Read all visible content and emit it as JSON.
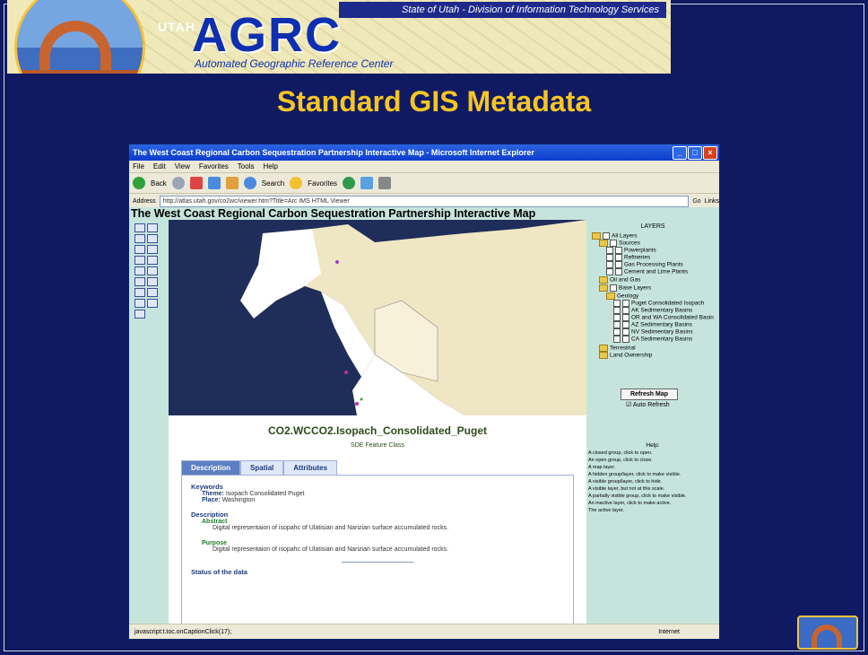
{
  "banner": {
    "utah": "UTAH",
    "agrc": "AGRC",
    "agrc_sub": "Automated Geographic Reference Center",
    "state_line": "State of Utah - Division of Information Technology Services"
  },
  "slide": {
    "title": "Standard GIS Metadata"
  },
  "browser": {
    "window_title": "The West Coast Regional Carbon Sequestration Partnership Interactive Map - Microsoft Internet Explorer",
    "menu": [
      "File",
      "Edit",
      "View",
      "Favorites",
      "Tools",
      "Help"
    ],
    "toolbar": {
      "back": "Back",
      "search": "Search",
      "favorites": "Favorites"
    },
    "address_label": "Address",
    "address_value": "http://atlas.utah.gov/co2wc/viewer.htm?Title=Arc IMS HTML Viewer",
    "go": "Go",
    "links": "Links",
    "page_title": "The West Coast Regional Carbon Sequestration Partnership Interactive Map",
    "status_text": "javascript:t.toc.onCaptionClick(17);",
    "status_zone": "Internet"
  },
  "layers": {
    "header": "LAYERS",
    "items": [
      "All Layers",
      "Sources",
      "Powerplants",
      "Refineries",
      "Gas Processing Plants",
      "Cement and Lime Plants",
      "Oil and Gas",
      "Base Layers",
      "Geology",
      "Puget Consolidated Isopach",
      "AK Sedimentary Basins",
      "OR and WA Consolidated Basin",
      "AZ Sedimentary Basins",
      "NV Sedimentary Basins",
      "CA Sedimentary Basins",
      "Terrestrial",
      "Land Ownership"
    ],
    "refresh": "Refresh Map",
    "auto_refresh": "Auto Refresh"
  },
  "help": {
    "title": "Help:",
    "lines": [
      "A closed group, click to open.",
      "An open group, click to close.",
      "A map layer.",
      "A hidden group/layer, click to make visible.",
      "A visible group/layer, click to hide.",
      "A visible layer, but not at this scale.",
      "A partially visible group, click to make visible.",
      "An inactive layer, click to make active.",
      "The active layer."
    ]
  },
  "metadata": {
    "title": "CO2.WCCO2.Isopach_Consolidated_Puget",
    "subtitle": "SDE Feature Class",
    "tabs": [
      "Description",
      "Spatial",
      "Attributes"
    ],
    "keywords_label": "Keywords",
    "theme_label": "Theme:",
    "theme_value": "Isopach Consolidated Puget",
    "place_label": "Place:",
    "place_value": "Washington",
    "description_label": "Description",
    "abstract_label": "Abstract",
    "abstract_text": "Digital representaion of isopahc of Ulatisian and Narizian surface accumulated rocks.",
    "purpose_label": "Purpose",
    "purpose_text": "Digital representaion of isopahc of Ulatisian and Narizian surface accumulated rocks.",
    "status_label": "Status of the data"
  },
  "colors": {
    "slide_bg": "#0f1a63",
    "title": "#f6c525",
    "panel_bg": "#c6e4dc"
  }
}
